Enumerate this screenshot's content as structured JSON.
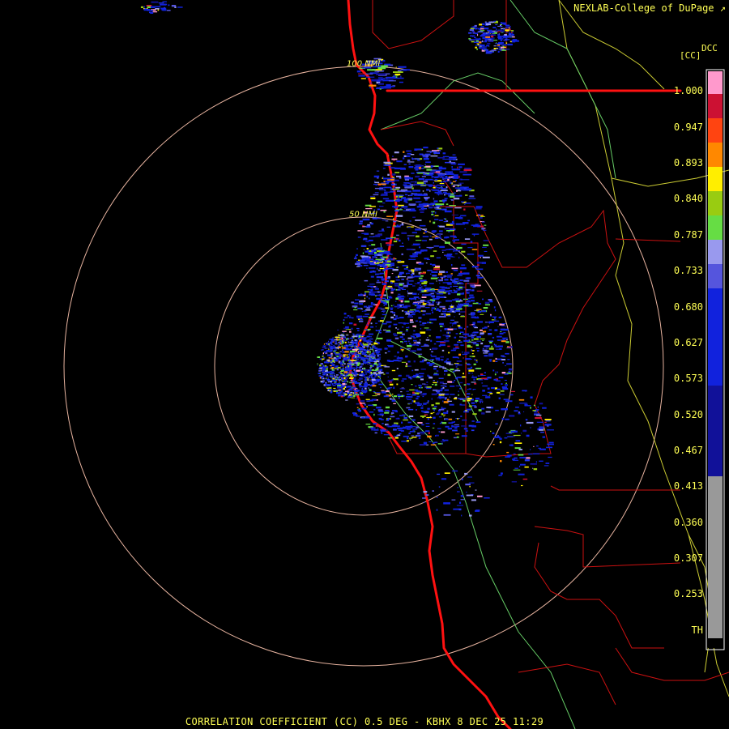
{
  "header": {
    "credit": "NEXLAB-College of DuPage",
    "product_code": "DCC",
    "units": "[CC]"
  },
  "footer": {
    "caption": "CORRELATION COEFFICIENT (CC) 0.5 DEG - KBHX 8 DEC 25 11:29"
  },
  "range_rings": [
    {
      "label": "50 NMI"
    },
    {
      "label": "100 NMI"
    }
  ],
  "colorbar": {
    "tick_labels": [
      "1.000",
      "0.947",
      "0.893",
      "0.840",
      "0.787",
      "0.733",
      "0.680",
      "0.627",
      "0.573",
      "0.520",
      "0.467",
      "0.413",
      "0.360",
      "0.307",
      "0.253",
      "TH"
    ],
    "colors": {
      "top_pink": "#ff99cc",
      "red": "#cc1133",
      "orange": "#ff8800",
      "yellow": "#ffee00",
      "green": "#66dd44",
      "lavender": "#9999ee",
      "blue": "#1122dd",
      "navy": "#111199",
      "gray": "#999999",
      "black": "#000000"
    }
  },
  "map_colors": {
    "coastline": "#ff1111",
    "borders": "#cc1111",
    "rivers": "#66cc66",
    "highways": "#cccc33",
    "range_rings": "#e8b4a0"
  }
}
